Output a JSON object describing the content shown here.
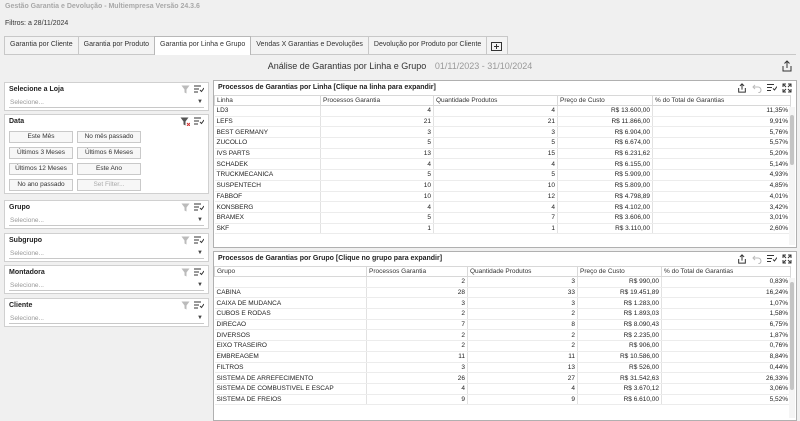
{
  "window": {
    "title": "Gestão Garantia e Devolução - Multiempresa Versão 24.3.6"
  },
  "filters_line": "Filtros: a 28/11/2024",
  "tabs": [
    {
      "label": "Garantia por Cliente"
    },
    {
      "label": "Garantia por Produto"
    },
    {
      "label": "Garantia por Linha e Grupo",
      "active": true
    },
    {
      "label": "Vendas X Garantias e Devoluções"
    },
    {
      "label": "Devolução por Produto por Cliente"
    }
  ],
  "page": {
    "title": "Análise de Garantias por Linha e Grupo",
    "date_range": "01/11/2023 - 31/10/2024"
  },
  "sidebar": {
    "loja": {
      "title": "Selecione a Loja",
      "placeholder": "Selecione..."
    },
    "data": {
      "title": "Data",
      "buttons": [
        "Este Mês",
        "No mês passado",
        "Últimos 3 Meses",
        "Últimos 6 Meses",
        "Últimos 12 Meses",
        "Este Ano",
        "No ano passado",
        "Set Filter..."
      ]
    },
    "grupo": {
      "title": "Grupo",
      "placeholder": "Selecione..."
    },
    "subgrupo": {
      "title": "Subgrupo",
      "placeholder": "Selecione..."
    },
    "montadora": {
      "title": "Montadora",
      "placeholder": "Selecione..."
    },
    "cliente": {
      "title": "Cliente",
      "placeholder": "Selecione..."
    }
  },
  "linha_grid": {
    "title": "Processos de Garantias por Linha [Clique na linha para expandir]",
    "columns": [
      "Linha",
      "Processos Garantia",
      "Quantidade Produtos",
      "Preço de Custo",
      "% do Total de Garantias"
    ],
    "rows": [
      [
        "LD3",
        "4",
        "4",
        "R$ 13.600,00",
        "11,35%"
      ],
      [
        "LEFS",
        "21",
        "21",
        "R$ 11.866,00",
        "9,91%"
      ],
      [
        "BEST GERMANY",
        "3",
        "3",
        "R$ 6.904,00",
        "5,76%"
      ],
      [
        "ZUCOLLO",
        "5",
        "5",
        "R$ 6.674,00",
        "5,57%"
      ],
      [
        "IVS PARTS",
        "13",
        "15",
        "R$ 6.231,62",
        "5,20%"
      ],
      [
        "SCHADEK",
        "4",
        "4",
        "R$ 6.155,00",
        "5,14%"
      ],
      [
        "TRUCKMECANICA",
        "5",
        "5",
        "R$ 5.909,00",
        "4,93%"
      ],
      [
        "SUSPENTECH",
        "10",
        "10",
        "R$ 5.809,00",
        "4,85%"
      ],
      [
        "FABBOF",
        "10",
        "12",
        "R$ 4.798,89",
        "4,01%"
      ],
      [
        "KONSBERG",
        "4",
        "4",
        "R$ 4.102,00",
        "3,42%"
      ],
      [
        "BRAMEX",
        "5",
        "7",
        "R$ 3.606,00",
        "3,01%"
      ],
      [
        "SKF",
        "1",
        "1",
        "R$ 3.110,00",
        "2,60%"
      ]
    ]
  },
  "grupo_grid": {
    "title": "Processos de Garantias por Grupo [Clique no grupo para expandir]",
    "columns": [
      "Grupo",
      "Processos Garantia",
      "Quantidade Produtos",
      "Preço de Custo",
      "% do Total de Garantias"
    ],
    "rows": [
      [
        "",
        "2",
        "3",
        "R$ 990,00",
        "0,83%"
      ],
      [
        "CABINA",
        "28",
        "33",
        "R$ 19.451,89",
        "16,24%"
      ],
      [
        "CAIXA DE MUDANCA",
        "3",
        "3",
        "R$ 1.283,00",
        "1,07%"
      ],
      [
        "CUBOS E RODAS",
        "2",
        "2",
        "R$ 1.893,03",
        "1,58%"
      ],
      [
        "DIRECAO",
        "7",
        "8",
        "R$ 8.090,43",
        "6,75%"
      ],
      [
        "DIVERSOS",
        "2",
        "2",
        "R$ 2.235,00",
        "1,87%"
      ],
      [
        "EIXO TRASEIRO",
        "2",
        "2",
        "R$ 906,00",
        "0,76%"
      ],
      [
        "EMBREAGEM",
        "11",
        "11",
        "R$ 10.586,00",
        "8,84%"
      ],
      [
        "FILTROS",
        "3",
        "13",
        "R$ 526,00",
        "0,44%"
      ],
      [
        "SISTEMA DE ARREFECIMENTO",
        "26",
        "27",
        "R$ 31.542,63",
        "26,33%"
      ],
      [
        "SISTEMA DE COMBUSTIVEL E ESCAP",
        "4",
        "4",
        "R$ 3.670,12",
        "3,06%"
      ],
      [
        "SISTEMA DE FREIOS",
        "9",
        "9",
        "R$ 6.610,00",
        "5,52%"
      ]
    ]
  }
}
